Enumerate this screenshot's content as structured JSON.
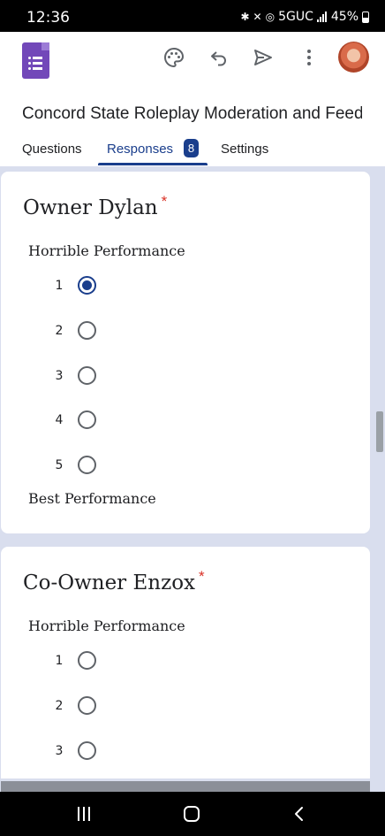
{
  "status": {
    "time": "12:36",
    "network": "5GUC",
    "battery": "45%"
  },
  "form": {
    "title": "Concord State Roleplay Moderation and Feedback"
  },
  "tabs": [
    {
      "label": "Questions"
    },
    {
      "label": "Responses",
      "badge": "8"
    },
    {
      "label": "Settings"
    }
  ],
  "questions": [
    {
      "title": "Owner Dylan",
      "required_mark": "*",
      "low_label": "Horrible Performance",
      "high_label": "Best Performance",
      "options": [
        "1",
        "2",
        "3",
        "4",
        "5"
      ],
      "selected": "1"
    },
    {
      "title": "Co-Owner Enzox",
      "required_mark": "*",
      "low_label": "Horrible Performance",
      "options": [
        "1",
        "2",
        "3"
      ]
    }
  ],
  "colors": {
    "accent": "#1a3e8c",
    "required": "#d93025",
    "forms_purple": "#7248b9",
    "page_bg": "#d9deee"
  },
  "icons": [
    "palette-icon",
    "undo-icon",
    "send-icon",
    "more-vert-icon",
    "recents-icon",
    "home-icon",
    "back-icon"
  ]
}
